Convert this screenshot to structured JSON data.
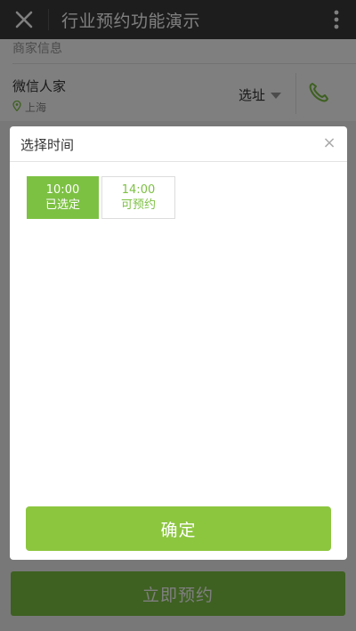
{
  "nav": {
    "title": "行业预约功能演示"
  },
  "page": {
    "section_title": "商家信息",
    "merchant_name": "微信人家",
    "merchant_location": "上海",
    "select_address_label": "选址",
    "book_now_label": "立即预约"
  },
  "modal": {
    "title": "选择时间",
    "close_symbol": "×",
    "slots": [
      {
        "time": "10:00",
        "status": "已选定"
      },
      {
        "time": "14:00",
        "status": "可预约"
      }
    ],
    "confirm_label": "确定"
  },
  "colors": {
    "accent": "#7dc143",
    "navbar": "#3a3a3a"
  }
}
